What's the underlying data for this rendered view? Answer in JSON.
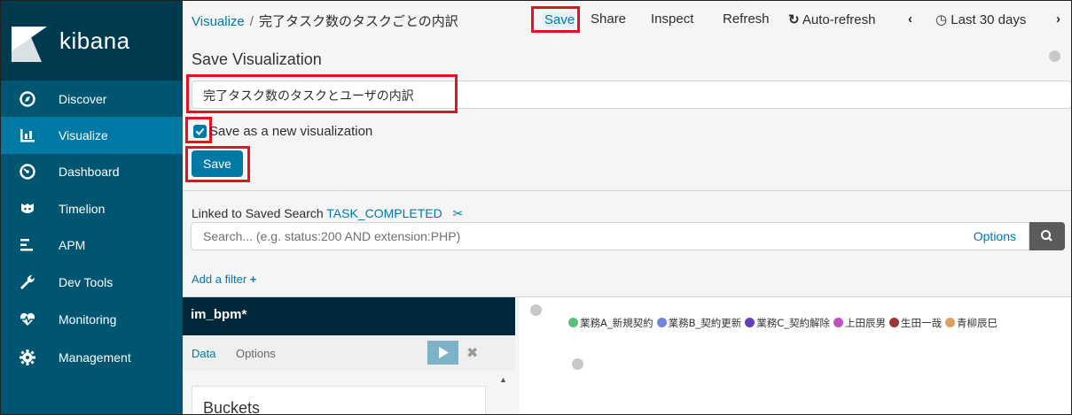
{
  "sidebar": {
    "brand": "kibana",
    "items": [
      {
        "label": "Discover",
        "icon": "compass-icon"
      },
      {
        "label": "Visualize",
        "icon": "bar-chart-icon"
      },
      {
        "label": "Dashboard",
        "icon": "dashboard-gauge-icon"
      },
      {
        "label": "Timelion",
        "icon": "timelion-icon"
      },
      {
        "label": "APM",
        "icon": "apm-icon"
      },
      {
        "label": "Dev Tools",
        "icon": "wrench-icon"
      },
      {
        "label": "Monitoring",
        "icon": "heartbeat-icon"
      },
      {
        "label": "Management",
        "icon": "gear-icon"
      }
    ],
    "active": "Visualize"
  },
  "topbar": {
    "breadcrumb_root": "Visualize",
    "breadcrumb_sep": "/",
    "breadcrumb_current": "完了タスク数のタスクごとの内訳",
    "save": "Save",
    "share": "Share",
    "inspect": "Inspect",
    "refresh": "Refresh",
    "auto_refresh": "Auto-refresh",
    "time_range": "Last 30 days"
  },
  "save_panel": {
    "title": "Save Visualization",
    "name_value": "完了タスク数のタスクとユーザの内訳",
    "checkbox_label": "Save as a new visualization",
    "checkbox_checked": true,
    "save_button": "Save"
  },
  "query": {
    "linked_prefix": "Linked to Saved Search",
    "saved_search": "TASK_COMPLETED",
    "search_placeholder": "Search... (e.g. status:200 AND extension:PHP)",
    "options": "Options",
    "add_filter": "Add a filter"
  },
  "editor": {
    "index_name": "im_bpm*",
    "tabs": [
      "Data",
      "Options"
    ],
    "section": "Buckets"
  },
  "legend": {
    "items": [
      {
        "label": "業務A_新規契約",
        "color": "#57c17b"
      },
      {
        "label": "業務B_契約更新",
        "color": "#6f87d8"
      },
      {
        "label": "業務C_契約解除",
        "color": "#663db8"
      },
      {
        "label": "上田辰男",
        "color": "#bc52bc"
      },
      {
        "label": "生田一哉",
        "color": "#9e3533"
      },
      {
        "label": "青柳辰巳",
        "color": "#daa05d"
      }
    ]
  },
  "colors": {
    "sidebar": "#005571",
    "sidebar_active": "#0079a5",
    "accent": "#0079a5",
    "highlight": "#e6101f"
  }
}
